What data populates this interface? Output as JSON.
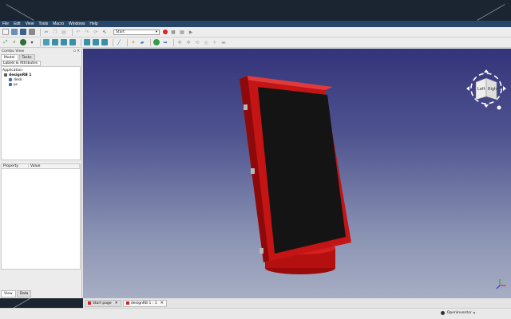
{
  "menu": [
    "File",
    "Edit",
    "View",
    "Tools",
    "Macro",
    "Windows",
    "Help"
  ],
  "toolbar": {
    "workbench": "Start",
    "workbench_arrow": "▾"
  },
  "combo": {
    "title": "Combo View",
    "tabs": [
      "Model",
      "Tasks"
    ],
    "active_tab": "Model",
    "sub_tab": "Labels & Attributes",
    "tree": {
      "section": "Application",
      "items": [
        {
          "label": "designRB 1",
          "depth": 1,
          "icon_color": "#5a5a5a"
        },
        {
          "label": "desk",
          "depth": 2,
          "icon_color": "#3a6fb0"
        },
        {
          "label": "pc",
          "depth": 2,
          "icon_color": "#3a6fb0"
        }
      ]
    },
    "property_headers": [
      "Property",
      "Value"
    ],
    "bottom_tabs": [
      "View",
      "Data"
    ]
  },
  "navcube": {
    "left_face": "Left",
    "right_face": "Righ"
  },
  "document_tabs": [
    {
      "label": "Start page",
      "active": false
    },
    {
      "label": "designRB 1 : 1",
      "active": true
    }
  ],
  "status": {
    "navigation": "OpenInventor",
    "navigation_arrow": "▴"
  },
  "colors": {
    "menubar": "#27476a",
    "model_red": "#c41414",
    "screen": "#141414"
  }
}
